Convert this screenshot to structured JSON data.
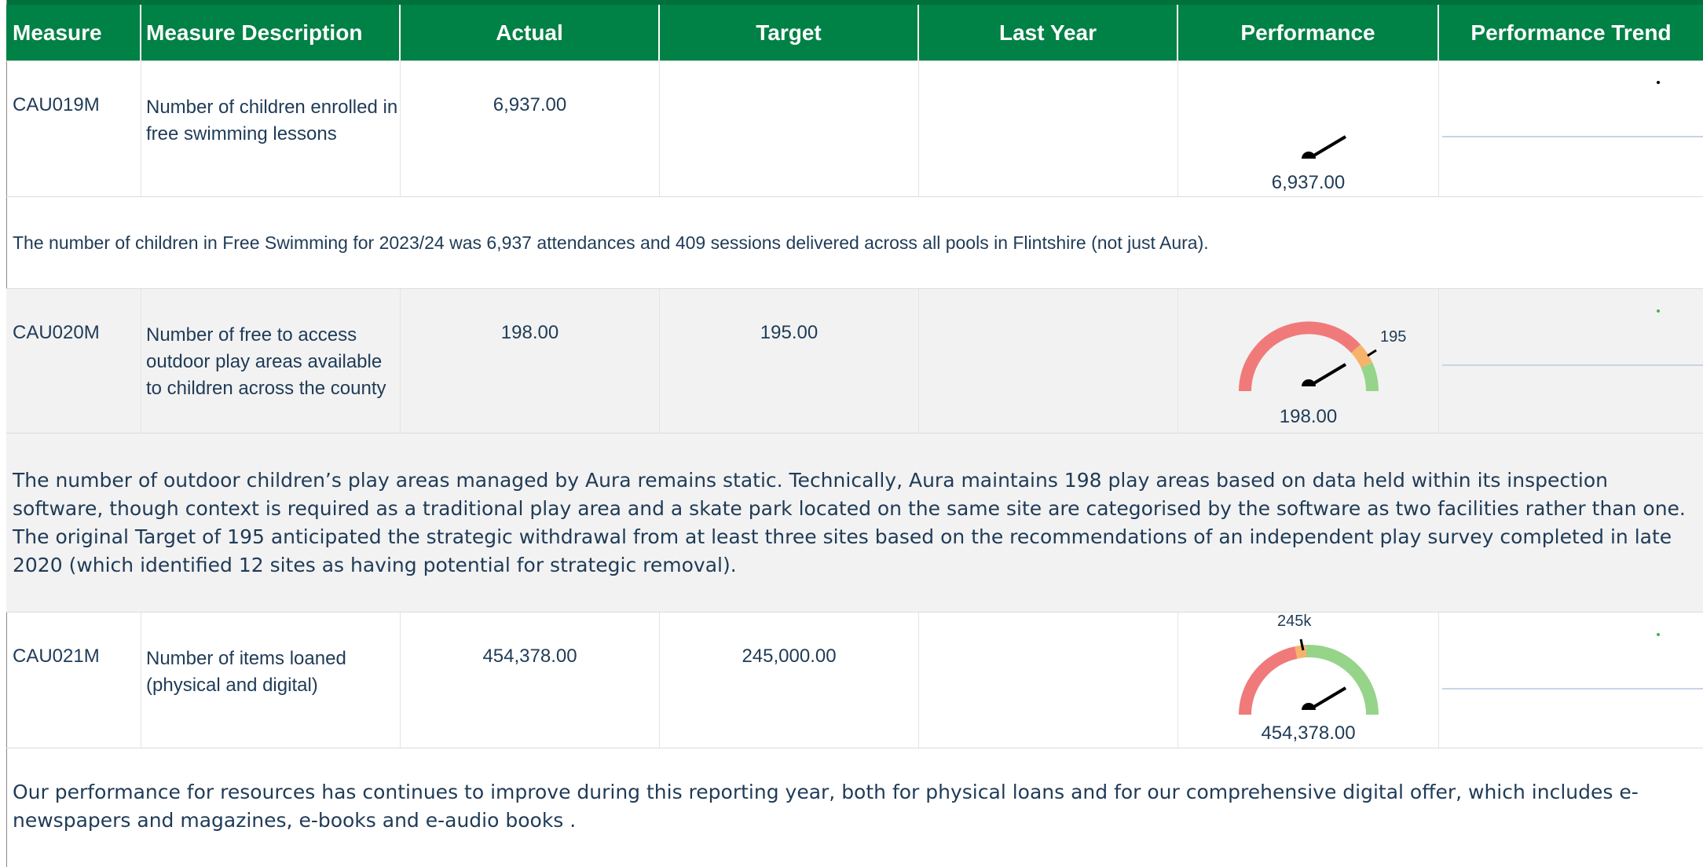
{
  "header": {
    "measure": "Measure",
    "description": "Measure Description",
    "actual": "Actual",
    "target": "Target",
    "last_year": "Last Year",
    "performance": "Performance",
    "trend": "Performance Trend"
  },
  "rows": [
    {
      "code": "CAU019M",
      "description": "Number of children enrolled in free swimming lessons",
      "actual": "6,937.00",
      "target": "",
      "last_year": "",
      "gauge_value": "6,937.00",
      "gauge_target": "",
      "note": "The number of children in Free Swimming for 2023/24 was 6,937 attendances and 409 sessions delivered across all pools in Flintshire (not just Aura)."
    },
    {
      "code": "CAU020M",
      "description": "Number of free to access outdoor play areas available to children across the county",
      "actual": "198.00",
      "target": "195.00",
      "last_year": "",
      "gauge_value": "198.00",
      "gauge_target": "195",
      "note": "The number of outdoor children’s play areas managed by Aura remains static. Technically, Aura maintains 198 play areas based on data held within its inspection software, though context is required as a traditional play area and a skate park located on the same site are categorised by the software as two facilities rather than one. The original Target of 195 anticipated the strategic withdrawal from at least three sites based on the recommendations of an independent play survey completed in late 2020 (which identified 12 sites as having potential for strategic removal)."
    },
    {
      "code": "CAU021M",
      "description": "Number of items loaned (physical and digital)",
      "actual": "454,378.00",
      "target": "245,000.00",
      "last_year": "",
      "gauge_value": "454,378.00",
      "gauge_target": "245k",
      "note": "Our performance for resources has continues to improve during this reporting year, both for physical loans and for our comprehensive digital offer, which includes e-newspapers and magazines, e-books and e-audio books ."
    }
  ],
  "colors": {
    "header_bg": "#008145",
    "gauge_red": "#f07a7a",
    "gauge_amber": "#f5b36b",
    "gauge_green": "#96d48a"
  }
}
